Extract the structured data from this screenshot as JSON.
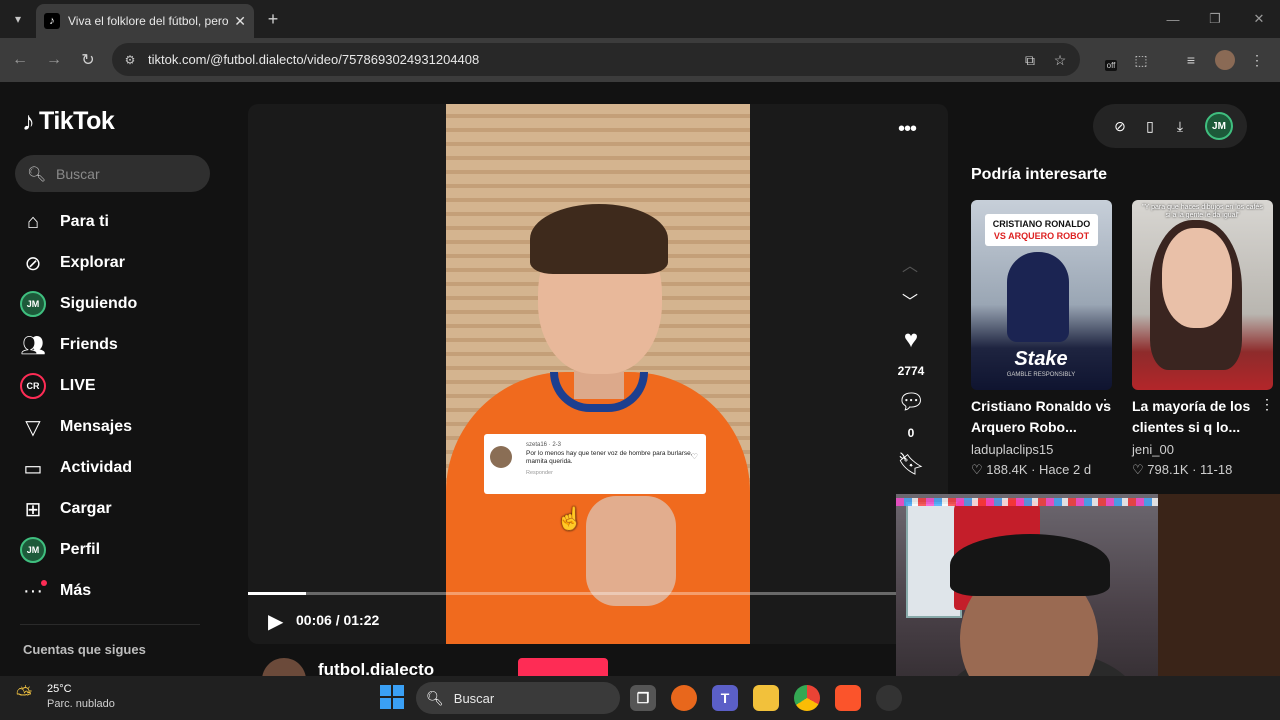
{
  "browser": {
    "tab_title": "Viva el folklore del fútbol, pero",
    "tab_favicon": "tiktok-logo",
    "url": "tiktok.com/@futbol.dialecto/video/7578693024931204408",
    "extension_badge": "off"
  },
  "tiktok": {
    "logo_text": "TikTok",
    "search_placeholder": "Buscar",
    "nav": [
      {
        "label": "Para ti",
        "icon": "home-icon"
      },
      {
        "label": "Explorar",
        "icon": "compass-icon"
      },
      {
        "label": "Siguiendo",
        "icon": "following-avatar-icon"
      },
      {
        "label": "Friends",
        "icon": "friends-icon"
      },
      {
        "label": "LIVE",
        "icon": "live-icon"
      },
      {
        "label": "Mensajes",
        "icon": "send-icon"
      },
      {
        "label": "Actividad",
        "icon": "activity-icon"
      },
      {
        "label": "Cargar",
        "icon": "upload-icon"
      },
      {
        "label": "Perfil",
        "icon": "profile-avatar-icon"
      },
      {
        "label": "Más",
        "icon": "more-icon"
      }
    ],
    "following_section_title": "Cuentas que sigues",
    "avatar_initials": "JM",
    "live_badge": "CR"
  },
  "video": {
    "time": "00:06 / 01:22",
    "progress": 0.09,
    "likes": "2774",
    "comments": "0",
    "author": "futbol.dialecto",
    "comment_card": {
      "user": "szeta16 · 2-3",
      "text": "Por lo menos hay que tener voz de hombre para burlarse, mamita querida.",
      "reply": "Responder"
    }
  },
  "recommendations": {
    "title": "Podría interesarte",
    "items": [
      {
        "title": "Cristiano Ronaldo vs Arquero Robo...",
        "author": "laduplaclips15",
        "stats": "188.4K · Hace 2 d",
        "thumb_banner_1": "CRISTIANO RONALDO",
        "thumb_banner_2": "VS ARQUERO ROBOT",
        "thumb_brand": "Stake",
        "thumb_sub": "GAMBLE RESPONSIBLY"
      },
      {
        "title": "La mayoría de los clientes si q lo...",
        "author": "jeni_00",
        "stats": "798.1K · 11-18",
        "thumb_caption": "\"Y para que haces dibujos en los cafés si a la gente le da igual\""
      }
    ]
  },
  "taskbar": {
    "temperature": "25°C",
    "weather": "Parc. nublado",
    "search_label": "Buscar"
  },
  "colors": {
    "brand_pink": "#fe2c55",
    "background": "#121212"
  }
}
